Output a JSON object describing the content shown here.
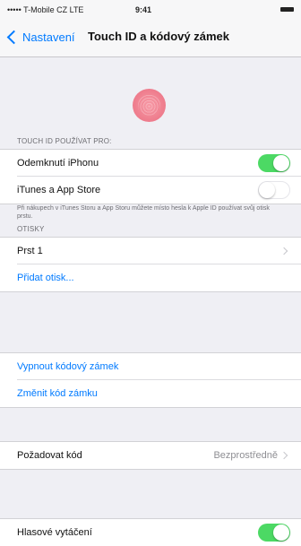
{
  "status_bar": {
    "carrier": "••••• T-Mobile CZ  LTE",
    "time": "9:41"
  },
  "nav": {
    "back_label": "Nastavení",
    "title": "Touch ID a kódový zámek"
  },
  "touch_id": {
    "section_header": "TOUCH ID POUŽÍVAT PRO:",
    "unlock_label": "Odemknutí iPhonu",
    "unlock_on": true,
    "itunes_label": "iTunes a App Store",
    "itunes_on": false,
    "note": "Při nákupech v iTunes Storu a App Storu můžete místo hesla k Apple ID používat svůj otisk prstu."
  },
  "fingerprints": {
    "section_header": "OTISKY",
    "items": [
      "Prst 1"
    ],
    "add_label": "Přidat otisk..."
  },
  "passcode": {
    "turn_off_label": "Vypnout kódový zámek",
    "change_label": "Změnit kód zámku"
  },
  "require": {
    "label": "Požadovat kód",
    "value": "Bezprostředně"
  },
  "voice_dial": {
    "label": "Hlasové vytáčení",
    "on": true
  },
  "colors": {
    "accent": "#007aff",
    "toggle_on": "#4cd964",
    "fingerprint": "#f07f8f"
  }
}
